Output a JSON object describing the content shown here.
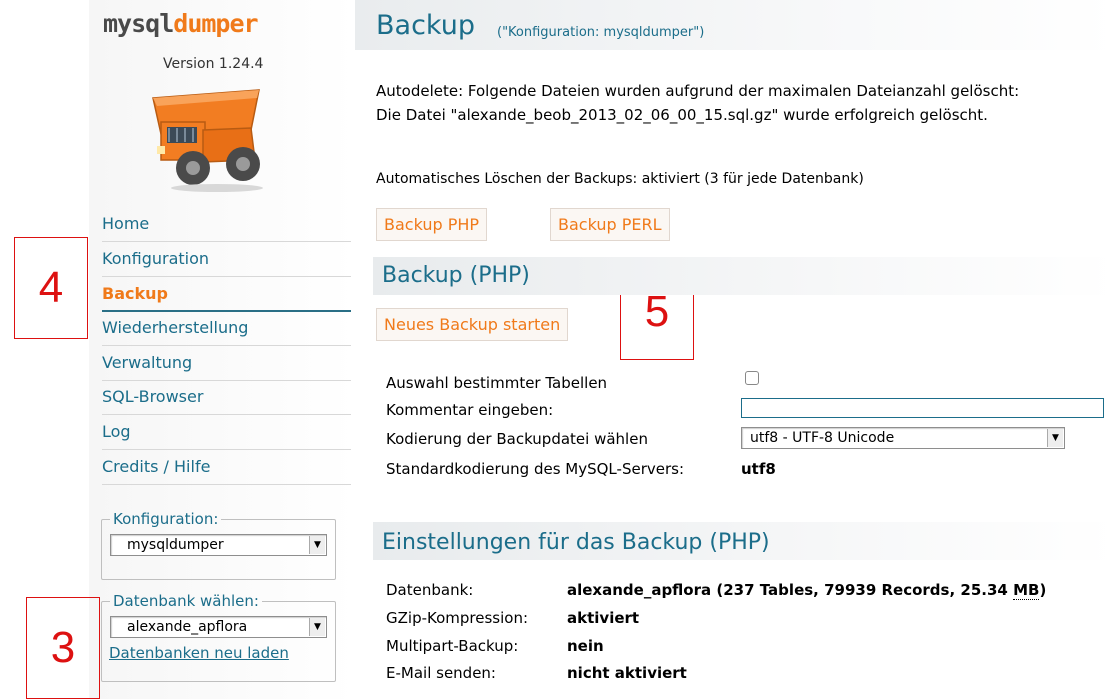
{
  "sidebar": {
    "logo_left": "mysql",
    "logo_right": "dumper",
    "version": "Version 1.24.4",
    "nav": [
      {
        "label": "Home"
      },
      {
        "label": "Konfiguration"
      },
      {
        "label": "Backup"
      },
      {
        "label": "Wiederherstellung"
      },
      {
        "label": "Verwaltung"
      },
      {
        "label": "SQL-Browser"
      },
      {
        "label": "Log"
      },
      {
        "label": "Credits / Hilfe"
      }
    ],
    "active_item": "Backup",
    "config_legend": "Konfiguration:",
    "config_value": "mysqldumper",
    "db_legend": "Datenbank wählen:",
    "db_value": "alexande_apflora",
    "reload_link": "Datenbanken neu laden"
  },
  "annotations": [
    "4",
    "5",
    "3"
  ],
  "header": {
    "title": "Backup",
    "subtitle": "(\"Konfiguration: mysqldumper\")"
  },
  "messages": {
    "line1": "Autodelete: Folgende Dateien wurden aufgrund der maximalen Dateianzahl gelöscht:",
    "line2": "Die Datei \"alexande_beob_2013_02_06_00_15.sql.gz\" wurde erfolgreich gelöscht.",
    "autodelete_status": "Automatisches Löschen der Backups: aktiviert (3 für jede Datenbank)"
  },
  "buttons": {
    "backup_php": "Backup PHP",
    "backup_perl": "Backup PERL",
    "start_backup": "Neues Backup starten"
  },
  "backup_php": {
    "title": "Backup (PHP)",
    "fields": {
      "select_tables": "Auswahl bestimmter Tabellen",
      "select_tables_checked": false,
      "comment": "Kommentar eingeben:",
      "comment_value": "",
      "encoding": "Kodierung der Backupdatei wählen",
      "encoding_value": "utf8 - UTF-8 Unicode",
      "default_encoding": "Standardkodierung des MySQL-Servers:",
      "default_encoding_value": "utf8"
    }
  },
  "settings": {
    "title": "Einstellungen für das Backup (PHP)",
    "rows": [
      {
        "label": "Datenbank:",
        "value": "alexande_apflora",
        "extra": "(237 Tables, 79939 Records, 25.34",
        "unit": "MB",
        "close": ")"
      },
      {
        "label": "GZip-Kompression:",
        "value": "aktiviert"
      },
      {
        "label": "Multipart-Backup:",
        "value": "nein"
      },
      {
        "label": "E-Mail senden:",
        "value": "nicht aktiviert"
      }
    ]
  },
  "colors": {
    "accent": "#f07a1a",
    "link": "#1b6d8a",
    "annotation": "#dd1111"
  }
}
